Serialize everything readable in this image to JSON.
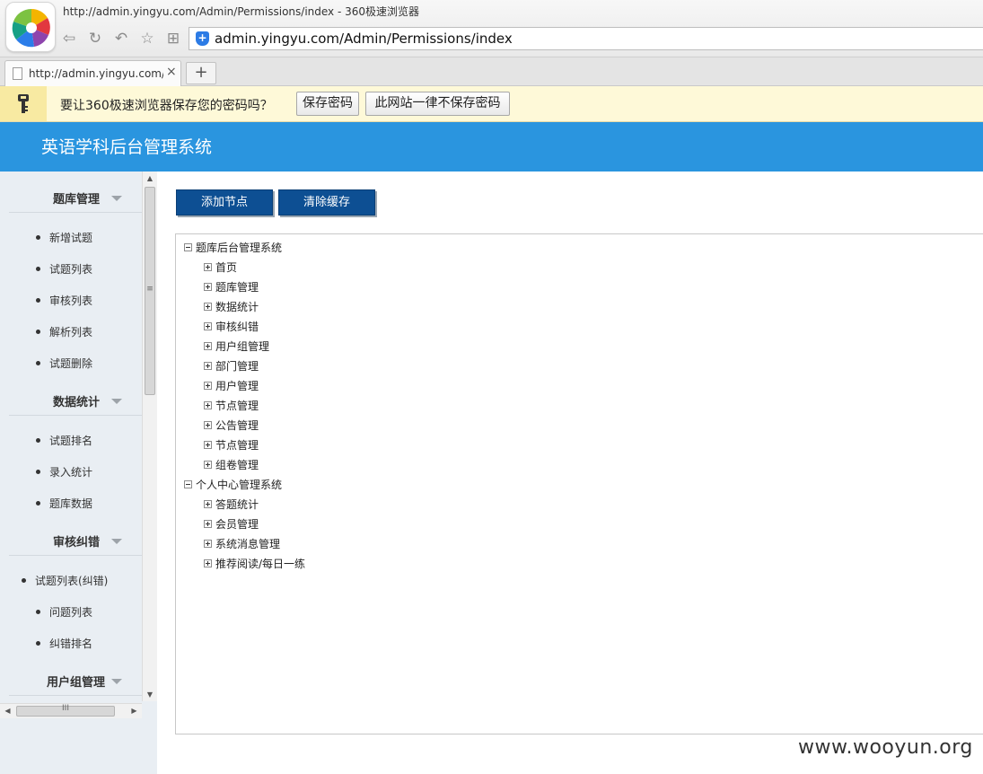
{
  "browser": {
    "window_title": "http://admin.yingyu.com/Admin/Permissions/index - 360极速浏览器",
    "address": "admin.yingyu.com/Admin/Permissions/index",
    "tab_label": "http://admin.yingyu.com/Admin/Permissions/index",
    "tab_close": "×",
    "new_tab": "+"
  },
  "password_bar": {
    "message": "要让360极速浏览器保存您的密码吗？",
    "save_label": "保存密码",
    "never_label": "此网站一律不保存密码"
  },
  "app": {
    "title": "英语学科后台管理系统"
  },
  "sidebar": {
    "sections": [
      {
        "title": "题库管理",
        "items": [
          "新增试题",
          "试题列表",
          "审核列表",
          "解析列表",
          "试题删除"
        ]
      },
      {
        "title": "数据统计",
        "items": [
          "试题排名",
          "录入统计",
          "题库数据"
        ]
      },
      {
        "title": "审核纠错",
        "items": [
          "试题列表(纠错)",
          "问题列表",
          "纠错排名"
        ]
      },
      {
        "title": "用户组管理",
        "items": []
      }
    ]
  },
  "toolbar": {
    "add_node": "添加节点",
    "clear_cache": "清除缓存"
  },
  "tree": [
    {
      "label": "题库后台管理系统",
      "expanded": true,
      "children": [
        "首页",
        "题库管理",
        "数据统计",
        "审核纠错",
        "用户组管理",
        "部门管理",
        "用户管理",
        "节点管理",
        "公告管理",
        "节点管理",
        "组卷管理"
      ]
    },
    {
      "label": "个人中心管理系统",
      "expanded": true,
      "children": [
        "答题统计",
        "会员管理",
        "系统消息管理",
        "推荐阅读/每日一练"
      ]
    }
  ],
  "watermark": "www.wooyun.org",
  "colors": {
    "header_blue": "#2a95df",
    "button_blue": "#0d4f93",
    "sidebar_bg": "#e9eef3",
    "password_bar_bg": "#fef9d8"
  }
}
